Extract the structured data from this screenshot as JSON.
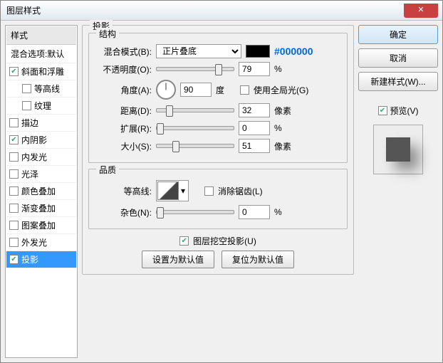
{
  "title": "图层样式",
  "hex_label": "#000000",
  "sidebar": {
    "head": "样式",
    "sub": "混合选项:默认",
    "items": [
      {
        "label": "斜面和浮雕",
        "checked": true,
        "indent": false
      },
      {
        "label": "等高线",
        "checked": false,
        "indent": true
      },
      {
        "label": "纹理",
        "checked": false,
        "indent": true
      },
      {
        "label": "描边",
        "checked": false,
        "indent": false
      },
      {
        "label": "内阴影",
        "checked": true,
        "indent": false
      },
      {
        "label": "内发光",
        "checked": false,
        "indent": false
      },
      {
        "label": "光泽",
        "checked": false,
        "indent": false
      },
      {
        "label": "颜色叠加",
        "checked": false,
        "indent": false
      },
      {
        "label": "渐变叠加",
        "checked": false,
        "indent": false
      },
      {
        "label": "图案叠加",
        "checked": false,
        "indent": false
      },
      {
        "label": "外发光",
        "checked": false,
        "indent": false
      },
      {
        "label": "投影",
        "checked": true,
        "indent": false,
        "selected": true
      }
    ]
  },
  "panel": {
    "title": "投影",
    "structure": {
      "legend": "结构",
      "blend_label": "混合模式(B):",
      "blend_value": "正片叠底",
      "opacity_label": "不透明度(O):",
      "opacity_value": "79",
      "percent": "%",
      "angle_label": "角度(A):",
      "angle_value": "90",
      "angle_unit": "度",
      "global_label": "使用全局光(G)",
      "distance_label": "距离(D):",
      "distance_value": "32",
      "px": "像素",
      "spread_label": "扩展(R):",
      "spread_value": "0",
      "size_label": "大小(S):",
      "size_value": "51"
    },
    "quality": {
      "legend": "品质",
      "contour_label": "等高线:",
      "antialias_label": "消除锯齿(L)",
      "noise_label": "杂色(N):",
      "noise_value": "0"
    },
    "knockout_label": "图层挖空投影(U)",
    "btn_default": "设置为默认值",
    "btn_reset": "复位为默认值"
  },
  "right": {
    "ok": "确定",
    "cancel": "取消",
    "newstyle": "新建样式(W)...",
    "preview_label": "预览(V)"
  }
}
